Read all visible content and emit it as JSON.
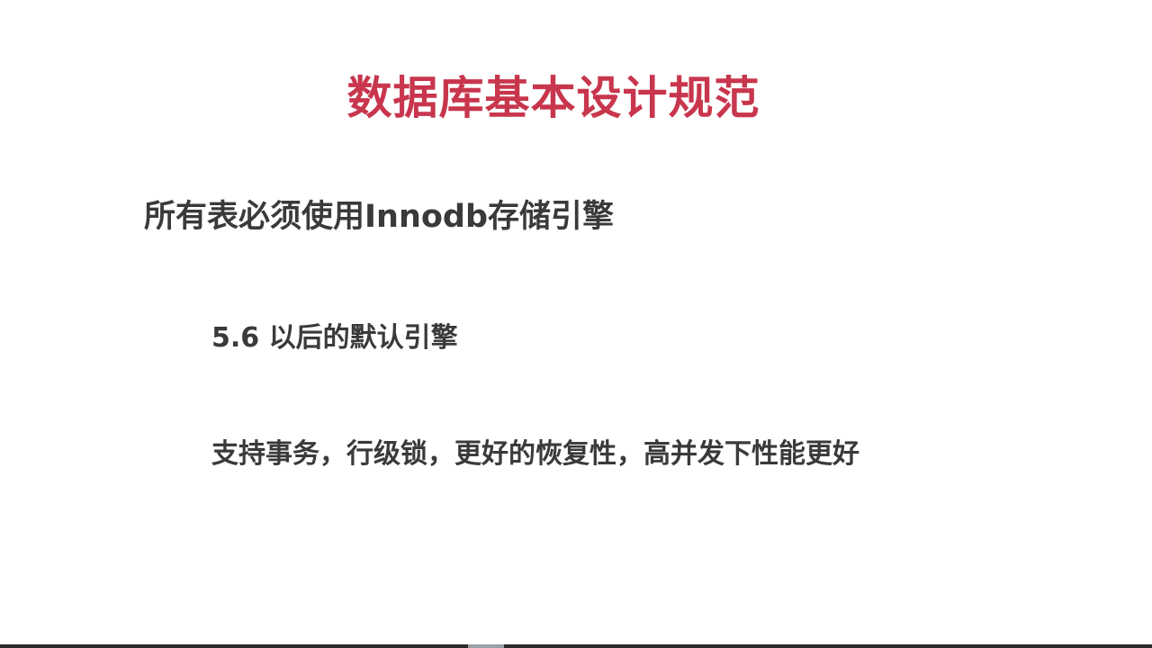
{
  "slide": {
    "title": "数据库基本设计规范",
    "bullets": [
      "所有表必须使用Innodb存储引擎",
      "5.6 以后的默认引擎",
      "支持事务，行级锁，更好的恢复性，高并发下性能更好"
    ]
  },
  "colors": {
    "title": "#c8364d",
    "body_text": "#3a3a3a",
    "background": "#ffffff"
  }
}
